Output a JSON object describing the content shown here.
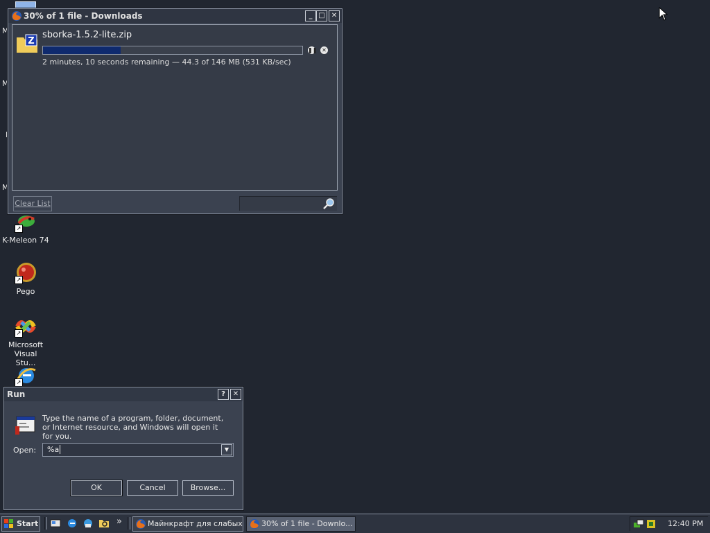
{
  "desktop": {
    "edge_letters": [
      "M",
      "M",
      "I",
      "M"
    ],
    "icons": [
      {
        "label": "K-Meleon 74",
        "icon": "k-meleon-icon"
      },
      {
        "label": "Pego",
        "icon": "pego-icon"
      },
      {
        "label": "Microsoft Visual Stu...",
        "icon": "visual-studio-icon"
      },
      {
        "label": "",
        "icon": "internet-explorer-icon"
      }
    ]
  },
  "downloads": {
    "title": "30% of 1 file - Downloads",
    "item": {
      "filename": "sborka-1.5.2-lite.zip",
      "status": "2 minutes, 10 seconds remaining — 44.3 of 146 MB (531 KB/sec)",
      "progress_fraction": 0.3
    },
    "clear_label": "Clear List",
    "search_value": ""
  },
  "run": {
    "title": "Run",
    "help_label": "?",
    "description": "Type the name of a program, folder, document, or Internet resource, and Windows will open it for you.",
    "open_label": "Open:",
    "open_value": "%a",
    "ok_label": "OK",
    "cancel_label": "Cancel",
    "browse_label": "Browse..."
  },
  "taskbar": {
    "start_label": "Start",
    "chevron": "»",
    "tasks": [
      {
        "label": "Майнкрафт для слабых ..."
      },
      {
        "label": "30% of 1 file - Downlo..."
      }
    ],
    "clock": "12:40 PM"
  },
  "colors": {
    "desktop": "#212630",
    "progress": "#0f2a6e",
    "window": "#3b4250"
  }
}
